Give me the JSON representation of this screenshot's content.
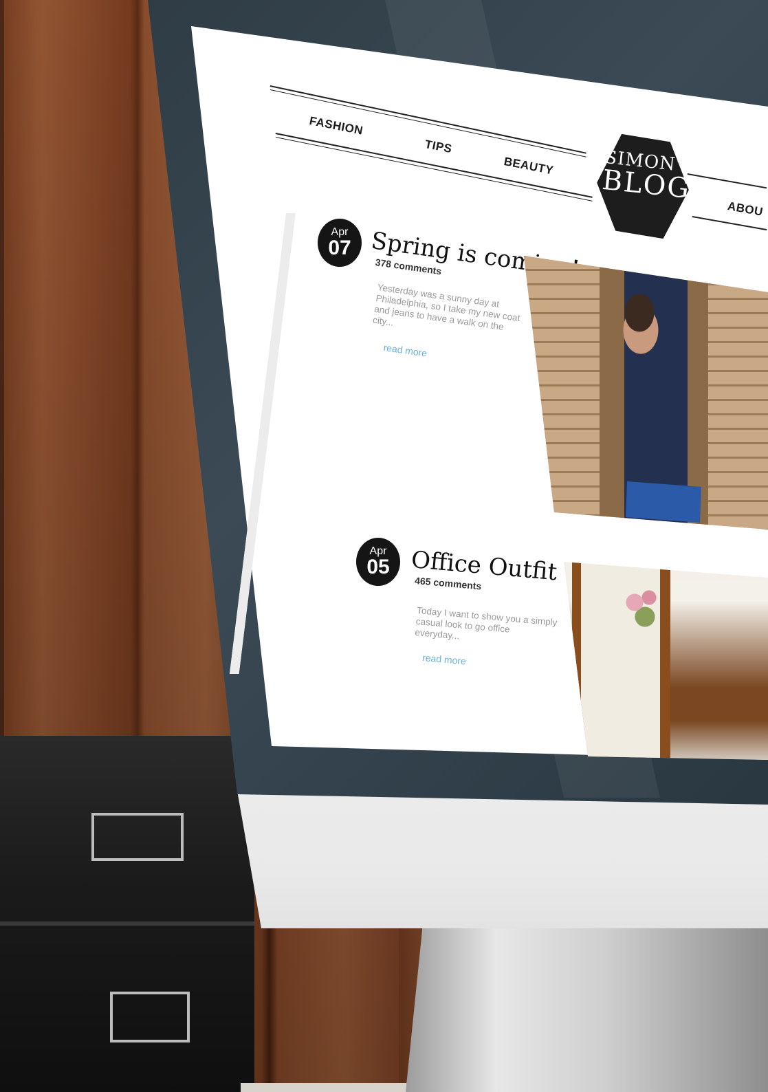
{
  "nav": {
    "items": [
      "FASHION",
      "TIPS",
      "BEAUTY",
      "ABOU"
    ]
  },
  "logo": {
    "line1": "SIMON'S",
    "line2": "BLOG"
  },
  "posts": [
    {
      "month": "Apr",
      "day": "07",
      "title": "Spring is coming!",
      "comments": "378 comments",
      "excerpt": "Yesterday was a sunny day at Philadelphia, so I take my new coat and jeans to have a walk on the city...",
      "read_more": "read more"
    },
    {
      "month": "Apr",
      "day": "05",
      "title": "Office Outfit",
      "comments": "465 comments",
      "excerpt": "Today I want to show you a simply casual look to go office everyday...",
      "read_more": "read more"
    }
  ],
  "colors": {
    "accent_link": "#6ab1d8",
    "date_badge": "#151515",
    "bezel": "#2c3942",
    "wall": "#8a4e2c"
  }
}
